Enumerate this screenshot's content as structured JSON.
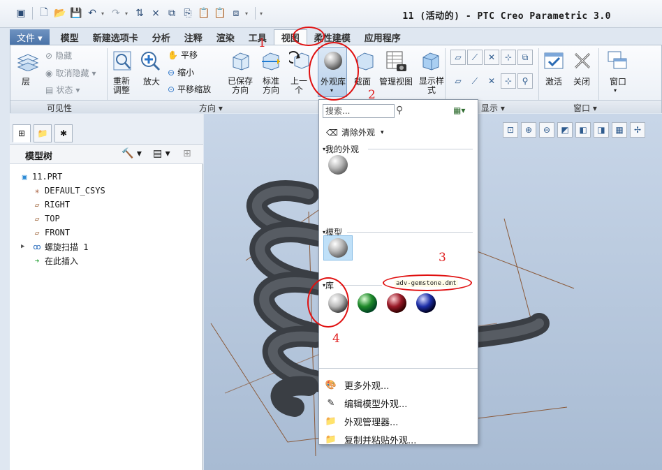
{
  "window": {
    "title": "11 (活动的) - PTC Creo Parametric 3.0"
  },
  "menu_tabs": [
    {
      "label": "文件 ▾"
    },
    {
      "label": "模型"
    },
    {
      "label": "新建选项卡"
    },
    {
      "label": "分析"
    },
    {
      "label": "注释"
    },
    {
      "label": "渲染"
    },
    {
      "label": "工具"
    },
    {
      "label": "视图"
    },
    {
      "label": "柔性建模"
    },
    {
      "label": "应用程序"
    }
  ],
  "ribbon": {
    "visibility": {
      "layer": "层",
      "hide": "隐藏",
      "unhide": "取消隐藏",
      "status": "状态",
      "group": "可见性"
    },
    "orientation": {
      "refit": "重新\n调整",
      "zoom_in": "放大",
      "pan": "平移",
      "zoom_out": "缩小",
      "pan_zoom": "平移缩放",
      "saved": "已保存\n方向",
      "standard": "标准\n方向",
      "previous": "上一\n个",
      "group": "方向 ▾"
    },
    "appearance_gallery": "外观库",
    "section": "截面",
    "manage_views": "管理视图",
    "display_style": "显示样\n式",
    "show_group": "显示 ▾",
    "window": {
      "activate": "激活",
      "close": "关闭",
      "windows": "窗口",
      "group": "窗口 ▾"
    }
  },
  "model_tree": {
    "header": "模型树",
    "items": [
      {
        "label": "11.PRT",
        "icon": "part-icon"
      },
      {
        "label": "DEFAULT_CSYS",
        "icon": "csys-icon"
      },
      {
        "label": "RIGHT",
        "icon": "datum-plane-icon"
      },
      {
        "label": "TOP",
        "icon": "datum-plane-icon"
      },
      {
        "label": "FRONT",
        "icon": "datum-plane-icon"
      },
      {
        "label": "螺旋扫描 1",
        "icon": "helical-sweep-icon"
      },
      {
        "label": "在此插入",
        "icon": "insert-here-icon"
      }
    ]
  },
  "gallery": {
    "search_placeholder": "搜索...",
    "clear": "清除外观",
    "my_appearances": "我的外观",
    "model": "模型",
    "library": "库",
    "tooltip": "adv-gemstone.dmt",
    "library_colors": [
      "#b9b9b9",
      "#1f8a2a",
      "#9a1a28",
      "#1d2fa8"
    ],
    "menu": [
      {
        "label": "更多外观...",
        "icon": "palette-icon"
      },
      {
        "label": "编辑模型外观...",
        "icon": "edit-appearance-icon"
      },
      {
        "label": "外观管理器...",
        "icon": "appearance-manager-icon"
      },
      {
        "label": "复制并粘贴外观...",
        "icon": "copy-paste-appearance-icon"
      }
    ]
  },
  "annotations": [
    "1",
    "2",
    "3",
    "4"
  ]
}
